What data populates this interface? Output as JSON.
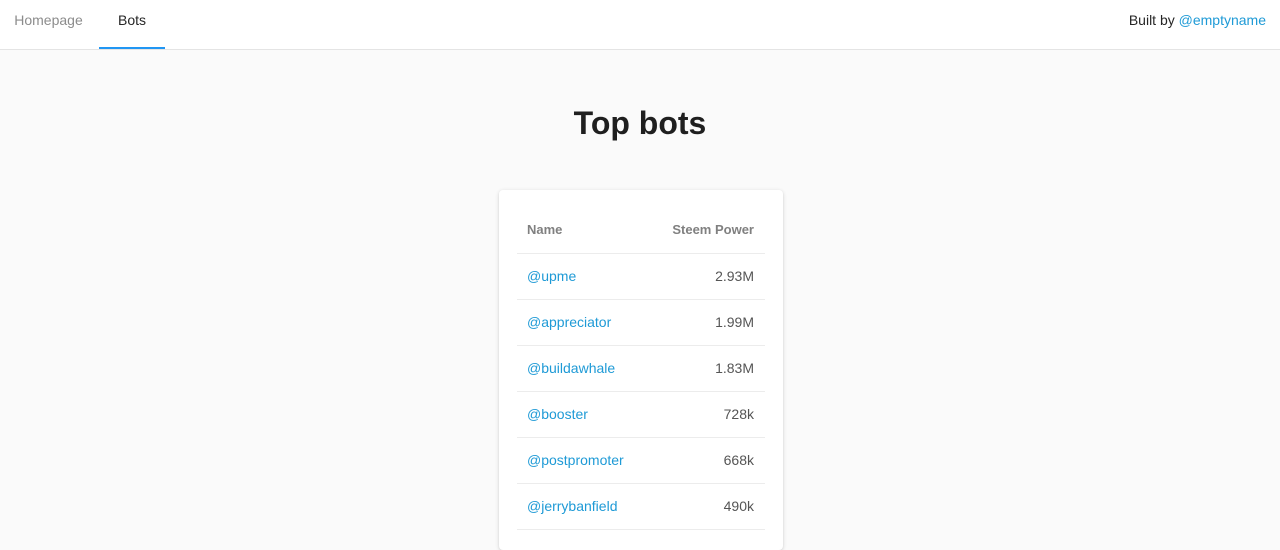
{
  "nav": {
    "tabs": [
      {
        "label": "Homepage",
        "active": false
      },
      {
        "label": "Bots",
        "active": true
      }
    ],
    "built_by_prefix": "Built by",
    "built_by_link": "@emptyname"
  },
  "page": {
    "title": "Top bots"
  },
  "table": {
    "columns": [
      "Name",
      "Steem Power"
    ],
    "rows": [
      {
        "name": "@upme",
        "steem_power": "2.93M"
      },
      {
        "name": "@appreciator",
        "steem_power": "1.99M"
      },
      {
        "name": "@buildawhale",
        "steem_power": "1.83M"
      },
      {
        "name": "@booster",
        "steem_power": "728k"
      },
      {
        "name": "@postpromoter",
        "steem_power": "668k"
      },
      {
        "name": "@jerrybanfield",
        "steem_power": "490k"
      }
    ]
  },
  "colors": {
    "link": "#1e9ad6",
    "active_tab_underline": "#2196f3",
    "background": "#fafafa"
  }
}
